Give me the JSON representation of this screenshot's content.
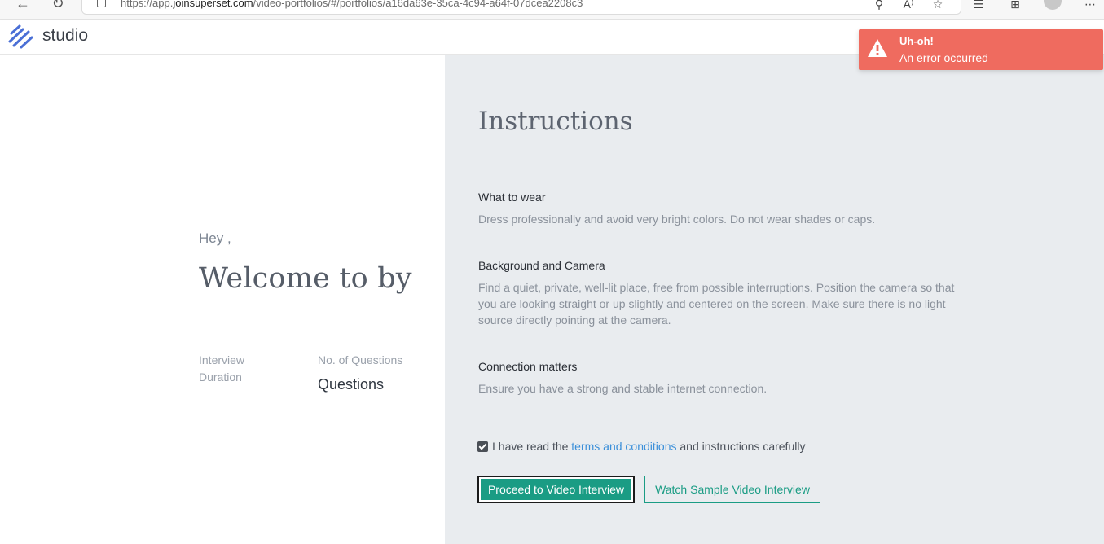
{
  "browser": {
    "url_prefix": "https://app.",
    "url_domain": "joinsuperset.com",
    "url_path": "/video-portfolios/#/portfolios/a16da63e-35ca-4c94-a64f-07dcea2208c3"
  },
  "header": {
    "brand": "studio"
  },
  "welcome": {
    "greeting": "Hey ,",
    "title": "Welcome to by",
    "duration_label": "Interview Duration",
    "questions_label": "No. of Questions",
    "questions_value": "Questions"
  },
  "instructions": {
    "title": "Instructions",
    "sections": [
      {
        "heading": "What to wear",
        "body": "Dress professionally and avoid very bright colors. Do not wear shades or caps."
      },
      {
        "heading": "Background and Camera",
        "body": "Find a quiet, private, well-lit place, free from possible interruptions. Position the camera so that you are looking straight or up slightly and centered on the screen. Make sure there is no light source directly pointing at the camera."
      },
      {
        "heading": "Connection matters",
        "body": "Ensure you have a strong and stable internet connection."
      }
    ],
    "agree_prefix": "I have read the ",
    "agree_link": "terms and conditions",
    "agree_suffix": " and instructions carefully",
    "agree_checked": true,
    "proceed_label": "Proceed to Video Interview",
    "sample_label": "Watch Sample Video Interview"
  },
  "toast": {
    "title": "Uh-oh!",
    "message": "An error occurred",
    "color": "#ef6b5f"
  },
  "colors": {
    "accent": "#1a9c84",
    "link": "#3b8fd9",
    "panel_bg": "#e9ecef"
  }
}
